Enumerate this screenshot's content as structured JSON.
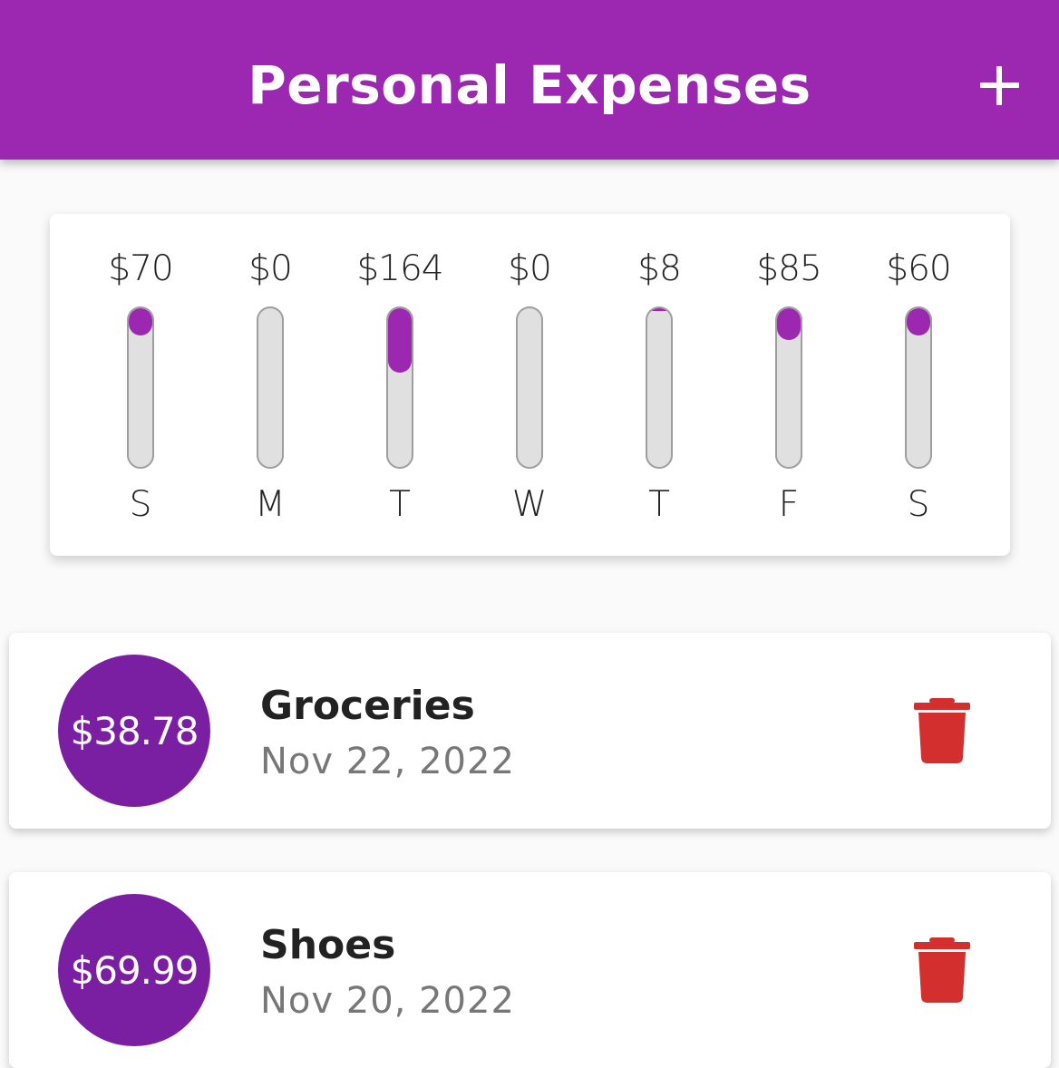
{
  "appbar": {
    "title": "Personal Expenses",
    "add_icon": "add-icon",
    "color": "#9c27b0"
  },
  "chart_data": {
    "type": "bar",
    "categories": [
      "S",
      "M",
      "T",
      "W",
      "T",
      "F",
      "S"
    ],
    "labels": [
      "$70",
      "$0",
      "$164",
      "$0",
      "$8",
      "$85",
      "$60"
    ],
    "values": [
      70,
      0,
      164,
      0,
      8,
      85,
      60
    ],
    "fill_fraction": [
      0.11,
      0.0,
      0.41,
      0.0,
      0.01,
      0.2,
      0.1
    ],
    "fill_color": "#9c27b0",
    "track_color": "#e0e0e0"
  },
  "transactions": [
    {
      "amount": "$38.78",
      "title": "Groceries",
      "date": "Nov 22, 2022",
      "delete_icon": "trash-icon"
    },
    {
      "amount": "$69.99",
      "title": "Shoes",
      "date": "Nov 20, 2022",
      "delete_icon": "trash-icon"
    }
  ],
  "colors": {
    "avatar": "#7b1fa2",
    "delete": "#d32f2f"
  }
}
